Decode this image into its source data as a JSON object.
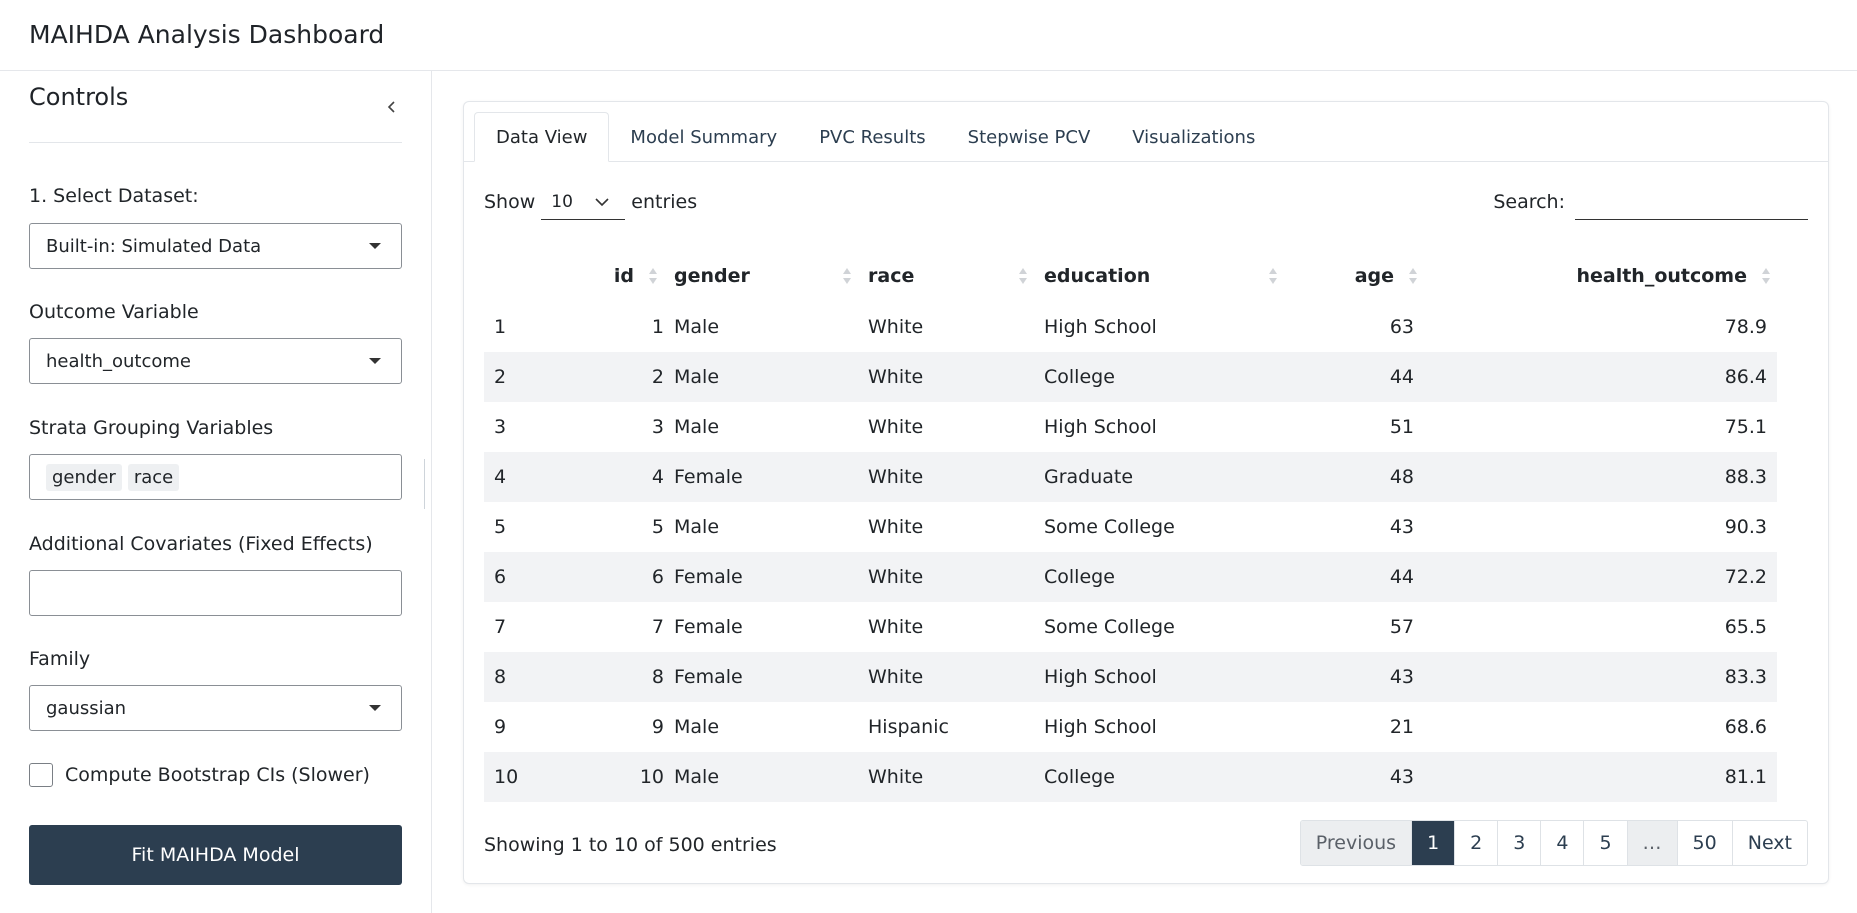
{
  "app": {
    "title": "MAIHDA Analysis Dashboard"
  },
  "sidebar": {
    "title": "Controls",
    "dataset": {
      "label": "1. Select Dataset:",
      "value": "Built-in: Simulated Data"
    },
    "outcome": {
      "label": "Outcome Variable",
      "value": "health_outcome"
    },
    "strata": {
      "label": "Strata Grouping Variables",
      "chips": [
        "gender",
        "race"
      ]
    },
    "covariates": {
      "label": "Additional Covariates (Fixed Effects)",
      "value": ""
    },
    "family": {
      "label": "Family",
      "value": "gaussian"
    },
    "bootstrap": {
      "label": "Compute Bootstrap CIs (Slower)",
      "checked": false
    },
    "fit_button": "Fit MAIHDA Model"
  },
  "tabs": [
    "Data View",
    "Model Summary",
    "PVC Results",
    "Stepwise PCV",
    "Visualizations"
  ],
  "table_controls": {
    "show_label": "Show",
    "length_value": "10",
    "entries_label": "entries",
    "search_label": "Search:"
  },
  "table": {
    "headers": [
      "",
      "id",
      "gender",
      "race",
      "education",
      "age",
      "health_outcome"
    ],
    "rows": [
      [
        "1",
        "1",
        "Male",
        "White",
        "High School",
        "63",
        "78.9"
      ],
      [
        "2",
        "2",
        "Male",
        "White",
        "College",
        "44",
        "86.4"
      ],
      [
        "3",
        "3",
        "Male",
        "White",
        "High School",
        "51",
        "75.1"
      ],
      [
        "4",
        "4",
        "Female",
        "White",
        "Graduate",
        "48",
        "88.3"
      ],
      [
        "5",
        "5",
        "Male",
        "White",
        "Some College",
        "43",
        "90.3"
      ],
      [
        "6",
        "6",
        "Female",
        "White",
        "College",
        "44",
        "72.2"
      ],
      [
        "7",
        "7",
        "Female",
        "White",
        "Some College",
        "57",
        "65.5"
      ],
      [
        "8",
        "8",
        "Female",
        "White",
        "High School",
        "43",
        "83.3"
      ],
      [
        "9",
        "9",
        "Male",
        "Hispanic",
        "High School",
        "21",
        "68.6"
      ],
      [
        "10",
        "10",
        "Male",
        "White",
        "College",
        "43",
        "81.1"
      ]
    ]
  },
  "info": "Showing 1 to 10 of 500 entries",
  "pagination": [
    "Previous",
    "1",
    "2",
    "3",
    "4",
    "5",
    "…",
    "50",
    "Next"
  ],
  "colors": {
    "primary": "#2c3e50",
    "stripe": "#f2f3f5"
  }
}
